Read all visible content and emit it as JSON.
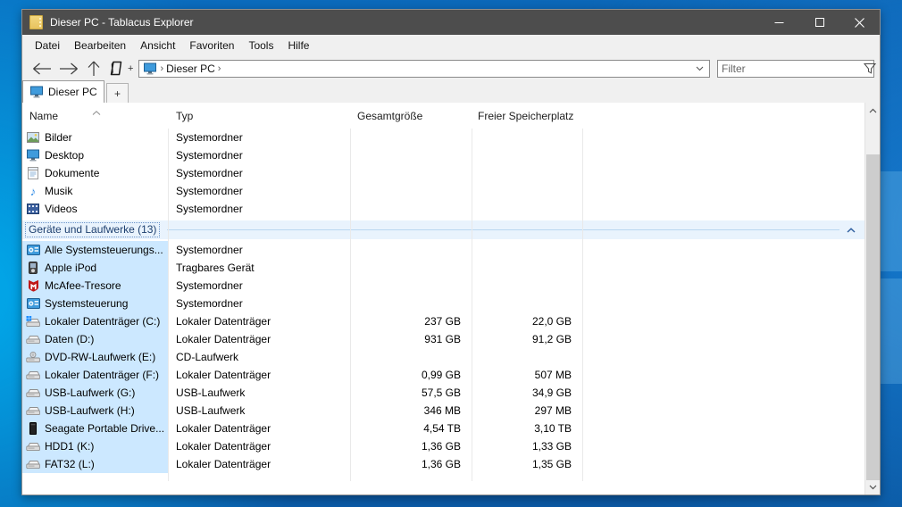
{
  "window": {
    "title": "Dieser PC - Tablacus Explorer"
  },
  "menu": {
    "items": [
      "Datei",
      "Bearbeiten",
      "Ansicht",
      "Favoriten",
      "Tools",
      "Hilfe"
    ]
  },
  "toolbar": {
    "clone_plus": "+",
    "address": {
      "chevron": "›",
      "crumb": "Dieser PC"
    },
    "filter_placeholder": "Filter"
  },
  "tabs": {
    "active_label": "Dieser PC",
    "new_tab_label": "+"
  },
  "columns": [
    "Name",
    "Typ",
    "Gesamtgröße",
    "Freier Speicherplatz"
  ],
  "colors": {
    "titlebar": "#4d4d4d",
    "selection": "#cce8ff",
    "group_band": "#e9f3fd",
    "group_text": "#1c3e6e",
    "desktop_blue": "#0c5fae"
  },
  "groups": [
    {
      "header": null,
      "items": [
        {
          "name": "Bilder",
          "type": "Systemordner",
          "size": "",
          "free": "",
          "icon": "picture",
          "selected": false
        },
        {
          "name": "Desktop",
          "type": "Systemordner",
          "size": "",
          "free": "",
          "icon": "monitor",
          "selected": false
        },
        {
          "name": "Dokumente",
          "type": "Systemordner",
          "size": "",
          "free": "",
          "icon": "document",
          "selected": false
        },
        {
          "name": "Musik",
          "type": "Systemordner",
          "size": "",
          "free": "",
          "icon": "music",
          "selected": false
        },
        {
          "name": "Videos",
          "type": "Systemordner",
          "size": "",
          "free": "",
          "icon": "video",
          "selected": false
        }
      ]
    },
    {
      "header": "Geräte und Laufwerke (13)",
      "items": [
        {
          "name": "Alle Systemsteuerungs...",
          "type": "Systemordner",
          "size": "",
          "free": "",
          "icon": "control-panel",
          "selected": true
        },
        {
          "name": "Apple iPod",
          "type": "Tragbares Gerät",
          "size": "",
          "free": "",
          "icon": "ipod",
          "selected": true
        },
        {
          "name": "McAfee-Tresore",
          "type": "Systemordner",
          "size": "",
          "free": "",
          "icon": "mcafee",
          "selected": true
        },
        {
          "name": "Systemsteuerung",
          "type": "Systemordner",
          "size": "",
          "free": "",
          "icon": "control-panel",
          "selected": true
        },
        {
          "name": "Lokaler Datenträger (C:)",
          "type": "Lokaler Datenträger",
          "size": "237 GB",
          "free": "22,0 GB",
          "icon": "system-drive",
          "selected": true
        },
        {
          "name": "Daten (D:)",
          "type": "Lokaler Datenträger",
          "size": "931 GB",
          "free": "91,2 GB",
          "icon": "drive",
          "selected": true
        },
        {
          "name": "DVD-RW-Laufwerk (E:)",
          "type": "CD-Laufwerk",
          "size": "",
          "free": "",
          "icon": "dvd-drive",
          "selected": true
        },
        {
          "name": "Lokaler Datenträger (F:)",
          "type": "Lokaler Datenträger",
          "size": "0,99 GB",
          "free": "507 MB",
          "icon": "drive",
          "selected": true
        },
        {
          "name": "USB-Laufwerk (G:)",
          "type": "USB-Laufwerk",
          "size": "57,5 GB",
          "free": "34,9 GB",
          "icon": "drive",
          "selected": true
        },
        {
          "name": "USB-Laufwerk (H:)",
          "type": "USB-Laufwerk",
          "size": "346 MB",
          "free": "297 MB",
          "icon": "drive",
          "selected": true
        },
        {
          "name": "Seagate Portable Drive...",
          "type": "Lokaler Datenträger",
          "size": "4,54 TB",
          "free": "3,10 TB",
          "icon": "external-drive",
          "selected": true
        },
        {
          "name": "HDD1 (K:)",
          "type": "Lokaler Datenträger",
          "size": "1,36 GB",
          "free": "1,33 GB",
          "icon": "drive",
          "selected": true
        },
        {
          "name": "FAT32 (L:)",
          "type": "Lokaler Datenträger",
          "size": "1,36 GB",
          "free": "1,35 GB",
          "icon": "drive",
          "selected": true
        }
      ]
    }
  ]
}
